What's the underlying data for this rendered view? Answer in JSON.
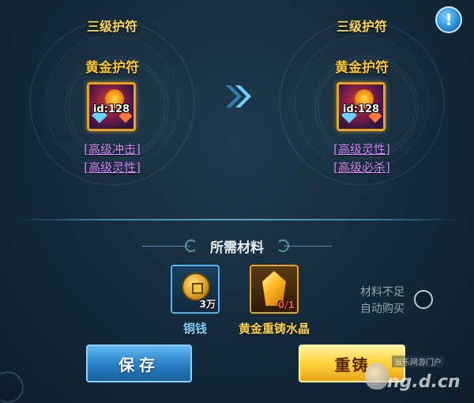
{
  "info_button": {
    "glyph": "!"
  },
  "left": {
    "tier": "三级护符",
    "item_name": "黄金护符",
    "item_id": "id:128",
    "attributes": [
      "[高级冲击]",
      "[高级灵性]"
    ]
  },
  "right": {
    "tier": "三级护符",
    "item_name": "黄金护符",
    "item_id": "id:128",
    "attributes": [
      "[高级灵性]",
      "[高级必杀]"
    ]
  },
  "materials": {
    "title": "所需材料",
    "items": [
      {
        "name": "铜钱",
        "quantity": "3万",
        "icon": "coin-icon"
      },
      {
        "name": "黄金重铸水晶",
        "quantity": "0/1",
        "icon": "crystal-icon"
      }
    ],
    "auto_buy_line1": "材料不足",
    "auto_buy_line2": "自动购买"
  },
  "buttons": {
    "save": "保存",
    "recast": "重铸"
  },
  "watermark": {
    "sub": "当乐网游门户",
    "main": "ng.d.cn"
  },
  "colors": {
    "tier_gold": "#ffd85a",
    "attr_purple": "#d78cff",
    "coin_blue": "#7fd0ff",
    "save_blue": "#2a83c8",
    "recast_gold": "#ffd23c"
  }
}
